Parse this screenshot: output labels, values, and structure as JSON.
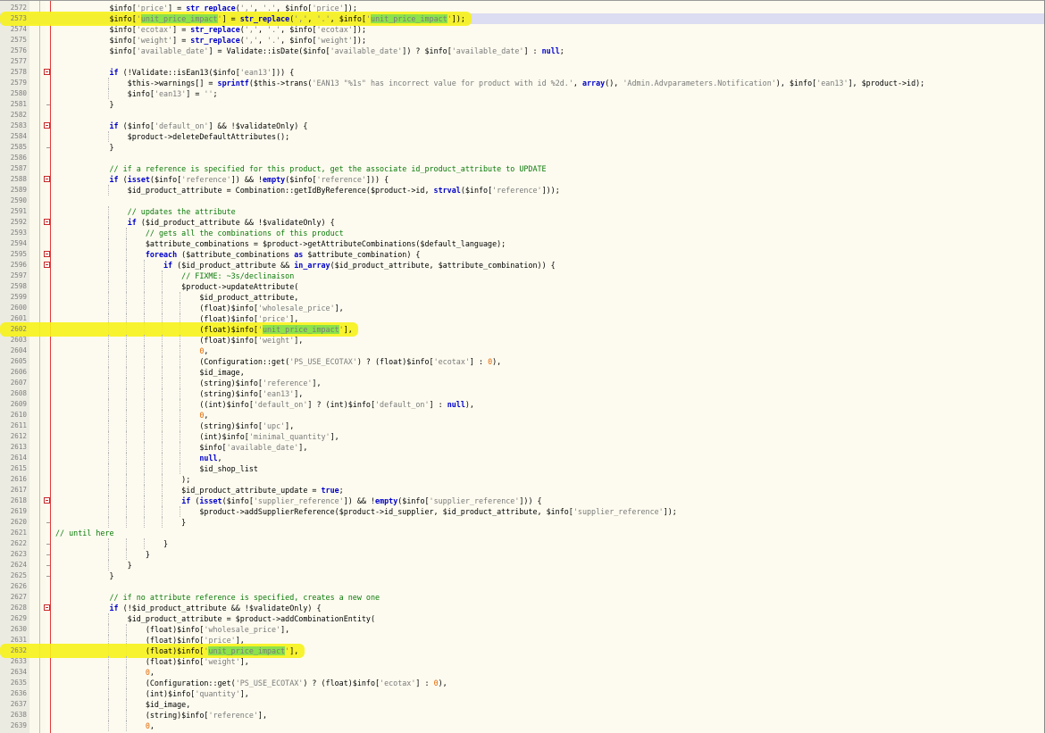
{
  "editor": {
    "lines": [
      {
        "n": "2572",
        "t": "            $info['price'] = str_replace(',', '.', $info['price']);"
      },
      {
        "n": "2573",
        "t": "            $info['unit_price_impact'] = str_replace(',', '.', $info['unit_price_impact']);"
      },
      {
        "n": "2574",
        "t": "            $info['ecotax'] = str_replace(',', '.', $info['ecotax']);"
      },
      {
        "n": "2575",
        "t": "            $info['weight'] = str_replace(',', '.', $info['weight']);"
      },
      {
        "n": "2576",
        "t": "            $info['available_date'] = Validate::isDate($info['available_date']) ? $info['available_date'] : null;"
      },
      {
        "n": "2577",
        "t": ""
      },
      {
        "n": "2578",
        "t": "            if (!Validate::isEan13($info['ean13'])) {"
      },
      {
        "n": "2579",
        "t": "                $this->warnings[] = sprintf($this->trans('EAN13 \"%1s\" has incorrect value for product with id %2d.', array(), 'Admin.Advparameters.Notification'), $info['ean13'], $product->id);"
      },
      {
        "n": "2580",
        "t": "                $info['ean13'] = '';"
      },
      {
        "n": "2581",
        "t": "            }"
      },
      {
        "n": "2582",
        "t": ""
      },
      {
        "n": "2583",
        "t": "            if ($info['default_on'] && !$validateOnly) {"
      },
      {
        "n": "2584",
        "t": "                $product->deleteDefaultAttributes();"
      },
      {
        "n": "2585",
        "t": "            }"
      },
      {
        "n": "2586",
        "t": ""
      },
      {
        "n": "2587",
        "t": "            // if a reference is specified for this product, get the associate id_product_attribute to UPDATE"
      },
      {
        "n": "2588",
        "t": "            if (isset($info['reference']) && !empty($info['reference'])) {"
      },
      {
        "n": "2589",
        "t": "                $id_product_attribute = Combination::getIdByReference($product->id, strval($info['reference']));"
      },
      {
        "n": "2590",
        "t": ""
      },
      {
        "n": "2591",
        "t": "                // updates the attribute"
      },
      {
        "n": "2592",
        "t": "                if ($id_product_attribute && !$validateOnly) {"
      },
      {
        "n": "2593",
        "t": "                    // gets all the combinations of this product"
      },
      {
        "n": "2594",
        "t": "                    $attribute_combinations = $product->getAttributeCombinations($default_language);"
      },
      {
        "n": "2595",
        "t": "                    foreach ($attribute_combinations as $attribute_combination) {"
      },
      {
        "n": "2596",
        "t": "                        if ($id_product_attribute && in_array($id_product_attribute, $attribute_combination)) {"
      },
      {
        "n": "2597",
        "t": "                            // FIXME: ~3s/declinaison"
      },
      {
        "n": "2598",
        "t": "                            $product->updateAttribute("
      },
      {
        "n": "2599",
        "t": "                                $id_product_attribute,"
      },
      {
        "n": "2600",
        "t": "                                (float)$info['wholesale_price'],"
      },
      {
        "n": "2601",
        "t": "                                (float)$info['price'],"
      },
      {
        "n": "2602",
        "t": "                                (float)$info['unit_price_impact'],"
      },
      {
        "n": "2603",
        "t": "                                (float)$info['weight'],"
      },
      {
        "n": "2604",
        "t": "                                0,"
      },
      {
        "n": "2605",
        "t": "                                (Configuration::get('PS_USE_ECOTAX') ? (float)$info['ecotax'] : 0),"
      },
      {
        "n": "2606",
        "t": "                                $id_image,"
      },
      {
        "n": "2607",
        "t": "                                (string)$info['reference'],"
      },
      {
        "n": "2608",
        "t": "                                (string)$info['ean13'],"
      },
      {
        "n": "2609",
        "t": "                                ((int)$info['default_on'] ? (int)$info['default_on'] : null),"
      },
      {
        "n": "2610",
        "t": "                                0,"
      },
      {
        "n": "2611",
        "t": "                                (string)$info['upc'],"
      },
      {
        "n": "2612",
        "t": "                                (int)$info['minimal_quantity'],"
      },
      {
        "n": "2613",
        "t": "                                $info['available_date'],"
      },
      {
        "n": "2614",
        "t": "                                null,"
      },
      {
        "n": "2615",
        "t": "                                $id_shop_list"
      },
      {
        "n": "2616",
        "t": "                            );"
      },
      {
        "n": "2617",
        "t": "                            $id_product_attribute_update = true;"
      },
      {
        "n": "2618",
        "t": "                            if (isset($info['supplier_reference']) && !empty($info['supplier_reference'])) {"
      },
      {
        "n": "2619",
        "t": "                                $product->addSupplierReference($product->id_supplier, $id_product_attribute, $info['supplier_reference']);"
      },
      {
        "n": "2620",
        "t": "                            }"
      },
      {
        "n": "2621",
        "t": "// until here"
      },
      {
        "n": "2622",
        "t": "                        }"
      },
      {
        "n": "2623",
        "t": "                    }"
      },
      {
        "n": "2624",
        "t": "                }"
      },
      {
        "n": "2625",
        "t": "            }"
      },
      {
        "n": "2626",
        "t": ""
      },
      {
        "n": "2627",
        "t": "            // if no attribute reference is specified, creates a new one"
      },
      {
        "n": "2628",
        "t": "            if (!$id_product_attribute && !$validateOnly) {"
      },
      {
        "n": "2629",
        "t": "                $id_product_attribute = $product->addCombinationEntity("
      },
      {
        "n": "2630",
        "t": "                    (float)$info['wholesale_price'],"
      },
      {
        "n": "2631",
        "t": "                    (float)$info['price'],"
      },
      {
        "n": "2632",
        "t": "                    (float)$info['unit_price_impact'],"
      },
      {
        "n": "2633",
        "t": "                    (float)$info['weight'],"
      },
      {
        "n": "2634",
        "t": "                    0,"
      },
      {
        "n": "2635",
        "t": "                    (Configuration::get('PS_USE_ECOTAX') ? (float)$info['ecotax'] : 0),"
      },
      {
        "n": "2636",
        "t": "                    (int)$info['quantity'],"
      },
      {
        "n": "2637",
        "t": "                    $id_image,"
      },
      {
        "n": "2638",
        "t": "                    (string)$info['reference'],"
      },
      {
        "n": "2639",
        "t": "                    0,"
      }
    ],
    "fold_open_lines": [
      "2578",
      "2583",
      "2588",
      "2592",
      "2595",
      "2596",
      "2618",
      "2628"
    ],
    "fold_end_lines": [
      "2581",
      "2585",
      "2620",
      "2622",
      "2623",
      "2624",
      "2625"
    ],
    "current_line": "2573",
    "highlighted_lines": [
      "2573",
      "2602",
      "2632"
    ],
    "search_term": "unit_price_impact",
    "colors": {
      "background": "#fdfbef",
      "gutter": "#ecebe2",
      "highlighter": "#f6f21a",
      "match": "#8be24a",
      "current_line": "#dcdcf2",
      "keyword": "#0000cc",
      "string": "#7a7a7a",
      "comment": "#0b7a0b",
      "number": "#e56600",
      "fold_marker": "#c62828"
    }
  }
}
